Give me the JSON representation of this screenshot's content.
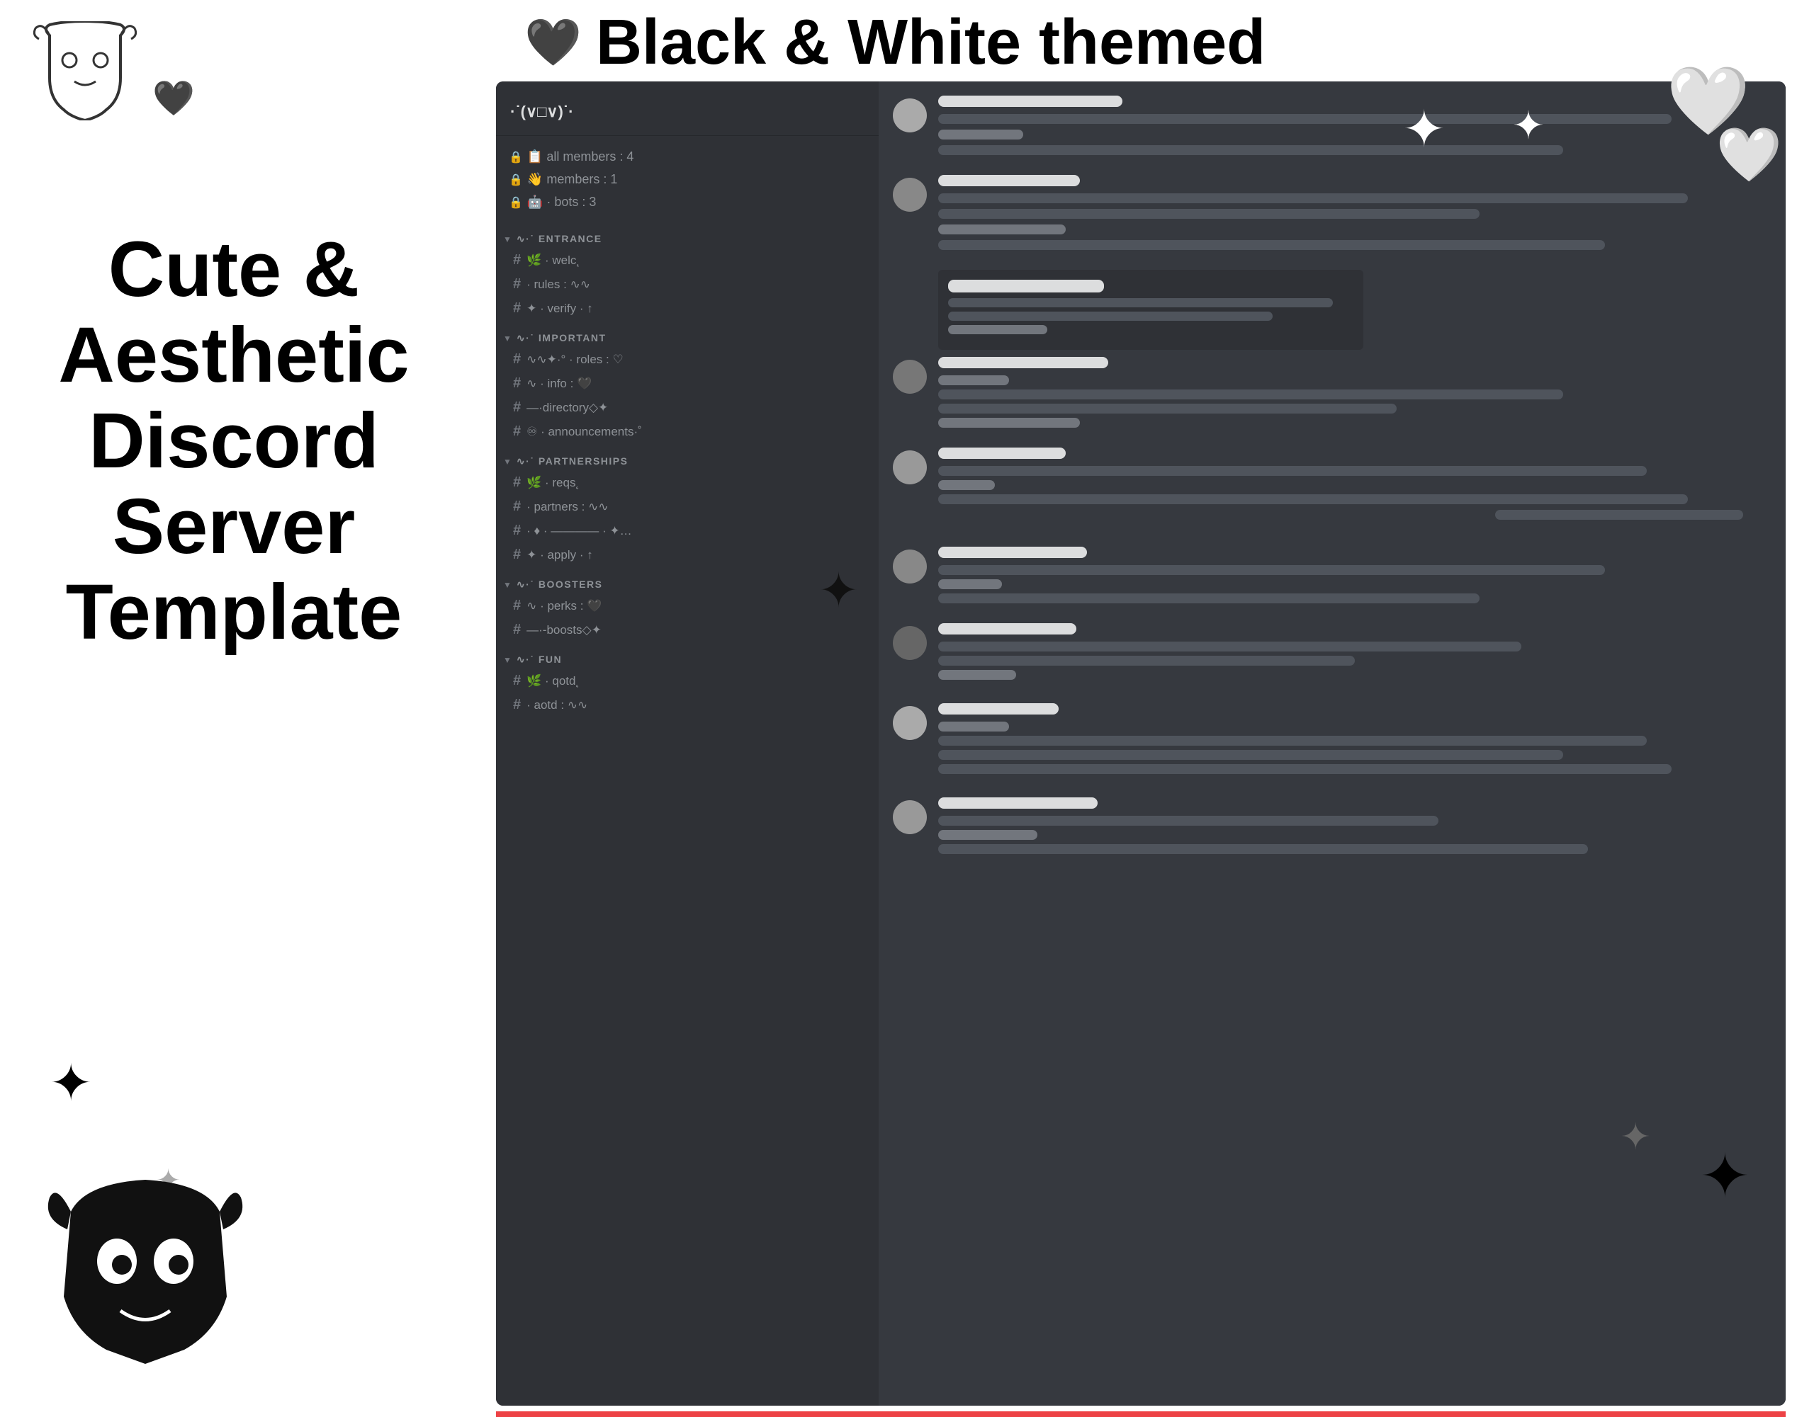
{
  "header": {
    "heart": "🖤",
    "title": "Black & White themed"
  },
  "left": {
    "main_title": "Cute &\nAesthetic\nDiscord\nServer\nTemplate"
  },
  "discord_ui": {
    "server_name": "·˙(∨□∨)˙·",
    "voice_channels": [
      {
        "icon": "🔒",
        "prefix": "📋",
        "text": "all members : 4"
      },
      {
        "icon": "🔒",
        "prefix": "👋",
        "text": "members : 1"
      },
      {
        "icon": "🔒",
        "prefix": "🤖",
        "text": "bots : 3"
      }
    ],
    "categories": [
      {
        "name": "ENTRANCE",
        "channels": [
          {
            "hash": "#",
            "name": "🌿 · welc˛"
          },
          {
            "hash": "#",
            "name": " · rules : ∿∿"
          },
          {
            "hash": "#",
            "name": "✦ · verify · ↑"
          }
        ]
      },
      {
        "name": "IMPORTANT",
        "channels": [
          {
            "hash": "#",
            "name": "∿∿✦·° · roles : ♡"
          },
          {
            "hash": "#",
            "name": "∿ · info : 🖤"
          },
          {
            "hash": "#",
            "name": "—·directory◇✦"
          },
          {
            "hash": "#",
            "name": "♾ · announcements·˚"
          }
        ]
      },
      {
        "name": "PARTNERSHIPS",
        "channels": [
          {
            "hash": "#",
            "name": "🌿 · reqs˛"
          },
          {
            "hash": "#",
            "name": " · partners : ∿∿"
          },
          {
            "hash": "#",
            "name": " · ♦ · ———————— · ✦…"
          },
          {
            "hash": "#",
            "name": "✦ · apply · ↑"
          }
        ]
      },
      {
        "name": "BOOSTERS",
        "channels": [
          {
            "hash": "#",
            "name": "∿ · perks : 🖤"
          },
          {
            "hash": "#",
            "name": "—·-boosts◇✦"
          }
        ]
      },
      {
        "name": "FUN",
        "channels": [
          {
            "hash": "#",
            "name": "🌿 · qotd˛"
          },
          {
            "hash": "#",
            "name": " · aotd : ∿∿"
          }
        ]
      }
    ]
  }
}
